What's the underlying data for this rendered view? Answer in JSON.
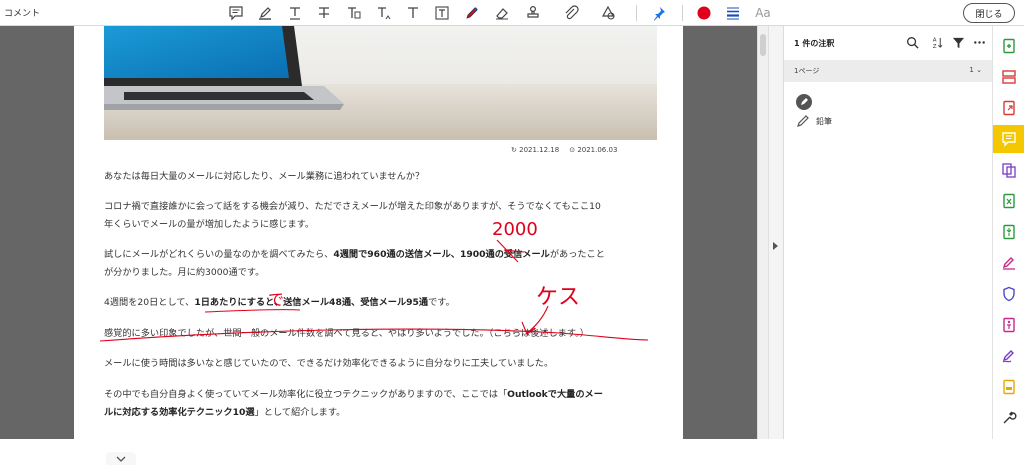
{
  "toolbar": {
    "title": "コメント",
    "tools": [
      {
        "icon": "sticky-note-icon"
      },
      {
        "icon": "highlight-icon"
      },
      {
        "icon": "underline-text-icon"
      },
      {
        "icon": "strikethrough-text-icon"
      },
      {
        "icon": "replace-text-icon"
      },
      {
        "icon": "insert-text-icon"
      },
      {
        "icon": "add-text-icon"
      },
      {
        "icon": "text-box-icon"
      },
      {
        "icon": "pencil-draw-icon"
      },
      {
        "icon": "eraser-icon"
      },
      {
        "icon": "stamp-icon"
      },
      {
        "icon": "attach-file-icon"
      },
      {
        "icon": "shapes-icon"
      },
      {
        "icon": "pin-icon"
      },
      {
        "icon": "color-picker-icon"
      },
      {
        "icon": "line-thickness-icon"
      },
      {
        "icon": "font-size-icon"
      }
    ],
    "font_size_label": "Aa",
    "close_label": "閉じる",
    "ink_color": "#e0001b",
    "pin_color": "#1a73e8"
  },
  "document": {
    "date_updated": "2021.12.18",
    "date_published": "2021.06.03",
    "paragraphs": [
      {
        "segments": [
          {
            "t": "あなたは毎日大量のメールに対応したり、メール業務に追われていませんか？",
            "b": false
          }
        ]
      },
      {
        "segments": [
          {
            "t": "コロナ禍で直接誰かに会って話をする機会が減り、ただでさえメールが増えた印象がありますが、そうでなくてもここ10",
            "b": false
          }
        ]
      },
      {
        "segments": [
          {
            "t": "年くらいでメールの量が増加したように感じます。",
            "b": false
          }
        ]
      },
      {
        "segments": [
          {
            "t": "試しにメールがどれくらいの量なのかを調べてみたら、",
            "b": false
          },
          {
            "t": "4週間で960通の送信メール、1900通の受信メール",
            "b": true
          },
          {
            "t": "があったこと",
            "b": false
          }
        ]
      },
      {
        "segments": [
          {
            "t": "が分かりました。月に約3000通です。",
            "b": false
          }
        ]
      },
      {
        "segments": [
          {
            "t": "4週間を20日として、",
            "b": false
          },
          {
            "t": "1日あたりにすると、送信メール48通、受信メール95通",
            "b": true
          },
          {
            "t": "です。",
            "b": false
          }
        ]
      },
      {
        "segments": [
          {
            "t": "感覚的に多い印象でしたが、世間一般のメール件数を調べて見ると、やはり多いようでした。（こちらは後述します。）",
            "b": false
          }
        ]
      },
      {
        "segments": [
          {
            "t": "メールに使う時間は多いなと感じていたので、できるだけ効率化できるように自分なりに工夫していました。",
            "b": false
          }
        ]
      },
      {
        "segments": [
          {
            "t": "その中でも自分自身よく使っていてメール効率化に役立つテクニックがありますので、ここでは「",
            "b": false
          },
          {
            "t": "Outlookで大量のメー",
            "b": true
          }
        ]
      },
      {
        "segments": [
          {
            "t": "ルに対応する効率化テクニック10選",
            "b": true
          },
          {
            "t": "」として紹介します。",
            "b": false
          }
        ]
      }
    ],
    "handwritten": {
      "annotation_1": "2000",
      "annotation_2": "で",
      "annotation_3": "ケス"
    }
  },
  "panel": {
    "title": "1 件の注釈",
    "page_label": "1ページ",
    "page_count": "1",
    "comment_type": "鉛筆"
  },
  "rightbar": {
    "items": [
      {
        "icon": "create-pdf-icon",
        "color": "#2b9a3e"
      },
      {
        "icon": "organize-pages-icon",
        "color": "#d93a3a"
      },
      {
        "icon": "export-pdf-icon",
        "color": "#d93a3a"
      },
      {
        "icon": "comment-icon",
        "color": "#ffffff",
        "active": true
      },
      {
        "icon": "combine-files-icon",
        "color": "#7a3cc7"
      },
      {
        "icon": "export-excel-icon",
        "color": "#2b9a3e"
      },
      {
        "icon": "compress-pdf-icon",
        "color": "#2b9a3e"
      },
      {
        "icon": "fill-sign-icon",
        "color": "#c7288a"
      },
      {
        "icon": "protect-icon",
        "color": "#4a4acd"
      },
      {
        "icon": "accessibility-icon",
        "color": "#c7288a"
      },
      {
        "icon": "sign-icon",
        "color": "#7a3cc7"
      },
      {
        "icon": "redact-icon",
        "color": "#e6a800"
      },
      {
        "icon": "tools-icon",
        "color": "#333333"
      }
    ]
  }
}
